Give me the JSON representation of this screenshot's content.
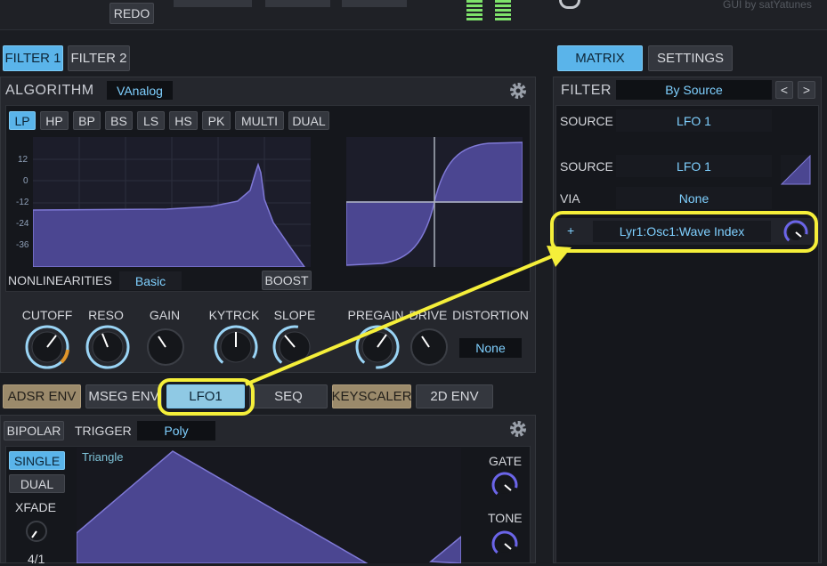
{
  "top": {
    "redo_label": "REDO",
    "credit": "GUI by satYatunes"
  },
  "filter_tabs": [
    "FILTER 1",
    "FILTER 2"
  ],
  "right_tabs": [
    "MATRIX",
    "SETTINGS"
  ],
  "algorithm": {
    "label": "ALGORITHM",
    "value": "VAnalog"
  },
  "filter_types": [
    "LP",
    "HP",
    "BP",
    "BS",
    "LS",
    "HS",
    "PK",
    "MULTI",
    "DUAL"
  ],
  "graph_ticks": [
    "12",
    "0",
    "-12",
    "-24",
    "-36"
  ],
  "nonlinearities": {
    "label": "NONLINEARITIES",
    "value": "Basic",
    "boost": "BOOST"
  },
  "knobs": {
    "cutoff": "CUTOFF",
    "reso": "RESO",
    "gain": "GAIN",
    "kytrck": "KYTRCK",
    "slope": "SLOPE",
    "pregain": "PREGAIN",
    "drive": "DRIVE",
    "distortion": "DISTORTION",
    "distortion_value": "None"
  },
  "mod_tabs": [
    "ADSR ENV",
    "MSEG ENV",
    "LFO1",
    "SEQ",
    "KEYSCALER",
    "2D ENV"
  ],
  "lfo": {
    "bipolar": "BIPOLAR",
    "trigger_label": "TRIGGER",
    "trigger_value": "Poly",
    "single": "SINGLE",
    "dual": "DUAL",
    "xfade": "XFADE",
    "rate": "4/1",
    "wave_name": "Triangle",
    "gate": "GATE",
    "tone": "TONE"
  },
  "matrix": {
    "filter_label": "FILTER",
    "filter_value": "By Source",
    "prev": "<",
    "next": ">",
    "source1_label": "SOURCE",
    "source1_value": "LFO 1",
    "source2_label": "SOURCE",
    "source2_value": "LFO 1",
    "via_label": "VIA",
    "via_value": "None",
    "plus": "+",
    "target": "Lyr1:Osc1:Wave Index"
  },
  "colors": {
    "accent": "#5ab4ea",
    "highlight": "#f5ef3a",
    "curve": "#4b4691"
  }
}
